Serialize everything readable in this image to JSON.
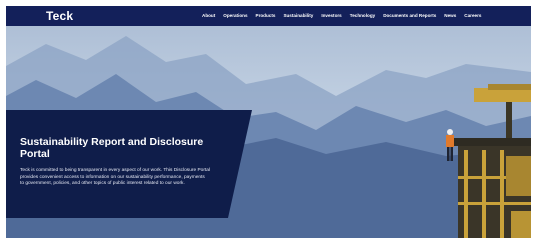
{
  "header": {
    "logo": "Teck",
    "nav": [
      "About",
      "Operations",
      "Products",
      "Sustainability",
      "Investors",
      "Technology",
      "Documents and Reports",
      "News",
      "Careers"
    ]
  },
  "hero": {
    "title": "Sustainability Report and Disclosure Portal",
    "description": "Teck is committed to being transparent in every aspect of our work. This Disclosure Portal provides convenient access to information on our sustainability performance, payments to government, policies, and other topics of public interest related to our work."
  },
  "colors": {
    "navbar": "#13205a",
    "panel": "#0f1d4a",
    "sky": "#c3d3e4",
    "mountain": "#5c7aa6",
    "accent_orange": "#e07a2c",
    "machine_yellow": "#c9a23a"
  }
}
